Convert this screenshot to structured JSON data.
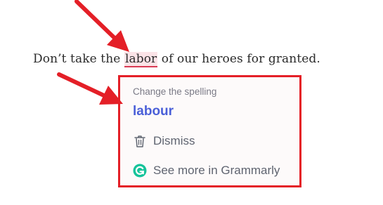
{
  "sentence": {
    "before": "Don’t take the ",
    "flagged_word": "labor",
    "after": " of our heroes for granted."
  },
  "popup": {
    "header": "Change the spelling",
    "suggestion": "labour",
    "dismiss_label": "Dismiss",
    "more_label": "See more in Grammarly"
  },
  "colors": {
    "highlight": "#fbe3e7",
    "underline": "#d93a55",
    "suggestion": "#4a5fd8",
    "grammarly_green": "#15c39a",
    "annotation_red": "#e41f27"
  },
  "icons": [
    "trash-icon",
    "grammarly-logo-icon",
    "arrow-annotation-icon"
  ]
}
